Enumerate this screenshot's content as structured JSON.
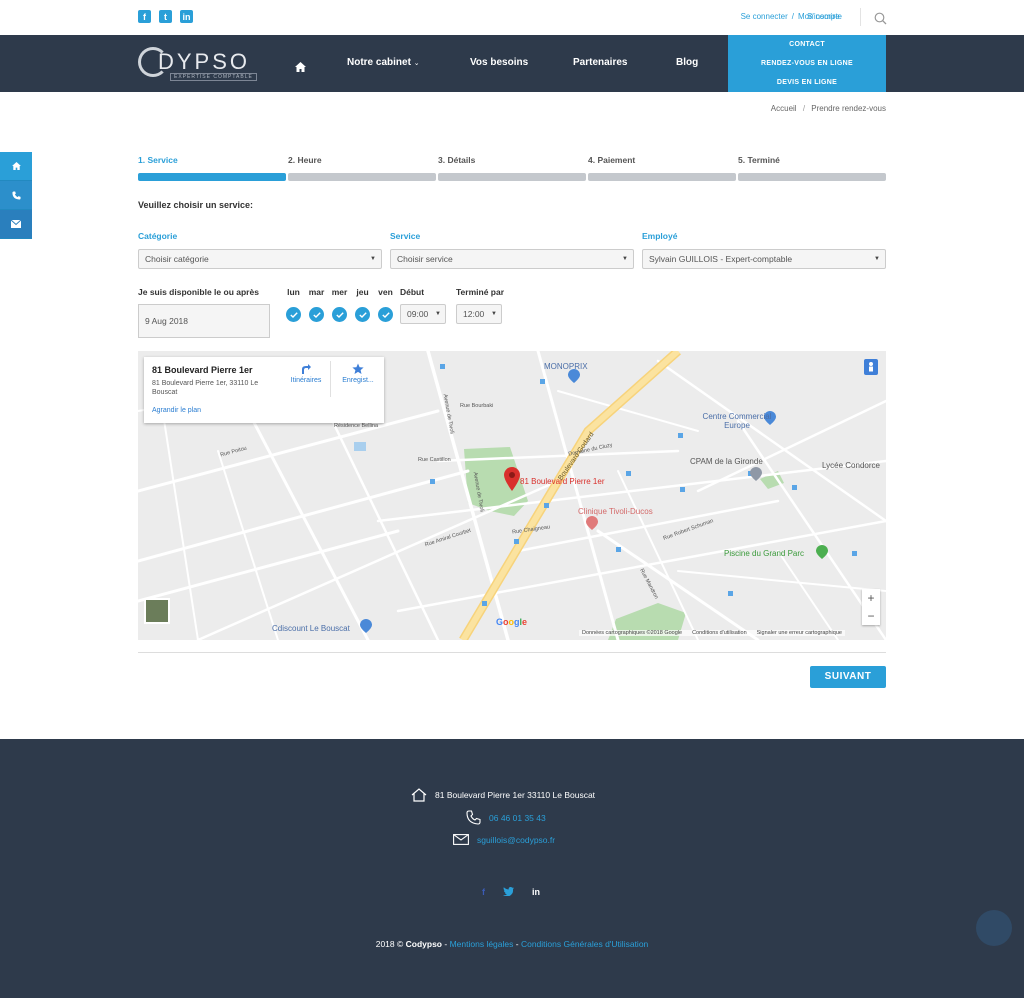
{
  "topbar": {
    "login": "Se connecter",
    "account": "Mon compte",
    "signup": "S'inscrire"
  },
  "brand": {
    "name": "CODYPSO",
    "tagline": "EXPERTISE COMPTABLE"
  },
  "nav": {
    "items": [
      "Notre cabinet",
      "Vos besoins",
      "Partenaires",
      "Blog"
    ],
    "cta": [
      "CONTACT",
      "RENDEZ-VOUS EN LIGNE",
      "DEVIS EN LIGNE"
    ]
  },
  "breadcrumb": [
    "Accueil",
    "Prendre rendez-vous"
  ],
  "steps": [
    "1. Service",
    "2. Heure",
    "3. Détails",
    "4. Paiement",
    "5. Terminé"
  ],
  "form": {
    "prompt": "Veuillez choisir un service:",
    "category_label": "Catégorie",
    "category_value": "Choisir catégorie",
    "service_label": "Service",
    "service_value": "Choisir service",
    "employee_label": "Employé",
    "employee_value": "Sylvain GUILLOIS - Expert-comptable",
    "avail_label": "Je suis disponible le ou après",
    "date_value": "9 Aug 2018",
    "days": [
      "lun",
      "mar",
      "mer",
      "jeu",
      "ven"
    ],
    "start_label": "Début",
    "start_value": "09:00",
    "end_label": "Terminé par",
    "end_value": "12:00",
    "next": "SUIVANT"
  },
  "map": {
    "card_title": "81 Boulevard Pierre 1er",
    "card_address": "81 Boulevard Pierre 1er, 33110 Le Bouscat",
    "directions": "Itinéraires",
    "save": "Enregist...",
    "enlarge": "Agrandir le plan",
    "pin_label": "81 Boulevard Pierre 1er",
    "places": {
      "monoprix": "MONOPRIX",
      "centre": "Centre Commercial Europe",
      "cpam": "CPAM de la Gironde",
      "lycee": "Lycée Condorce",
      "clinique": "Clinique Tivoli-Ducos",
      "piscine": "Piscine du Grand Parc",
      "cdiscount": "Cdiscount Le Bouscat"
    },
    "streets": {
      "godard": "Boulevard Godard",
      "tivoli1": "Avenue de Tivoli",
      "tivoli2": "Avenue de Tivoli",
      "bourbaki": "Rue Bourbaki",
      "castillon": "Rue Castillon",
      "residence": "Résidence Bellina",
      "poitou": "Rue Poitou",
      "amiral": "Rue Amiral Courbet",
      "chaigneau": "Rue Chaigneau",
      "robert": "Rue Robert Schuman",
      "mandron": "Rue Mandron",
      "domaine": "Domaine du Cluzy"
    },
    "footer": [
      "Données cartographiques ©2018 Google",
      "Conditions d'utilisation",
      "Signaler une erreur cartographique"
    ],
    "zoom_in": "+",
    "zoom_out": "−",
    "google": "Google"
  },
  "footer": {
    "address": "81 Boulevard Pierre 1er 33110 Le Bouscat",
    "phone": "06 46 01 35 43",
    "email": "sguillois@codypso.fr",
    "copy_year": "2018 ©",
    "copy_brand": "Codypso",
    "legal": "Mentions légales",
    "cgu": "Conditions Générales d'Utilisation"
  },
  "colors": {
    "accent": "#2a9fd8",
    "navbar": "#2e3a4b",
    "footer": "#2e3a4b"
  }
}
